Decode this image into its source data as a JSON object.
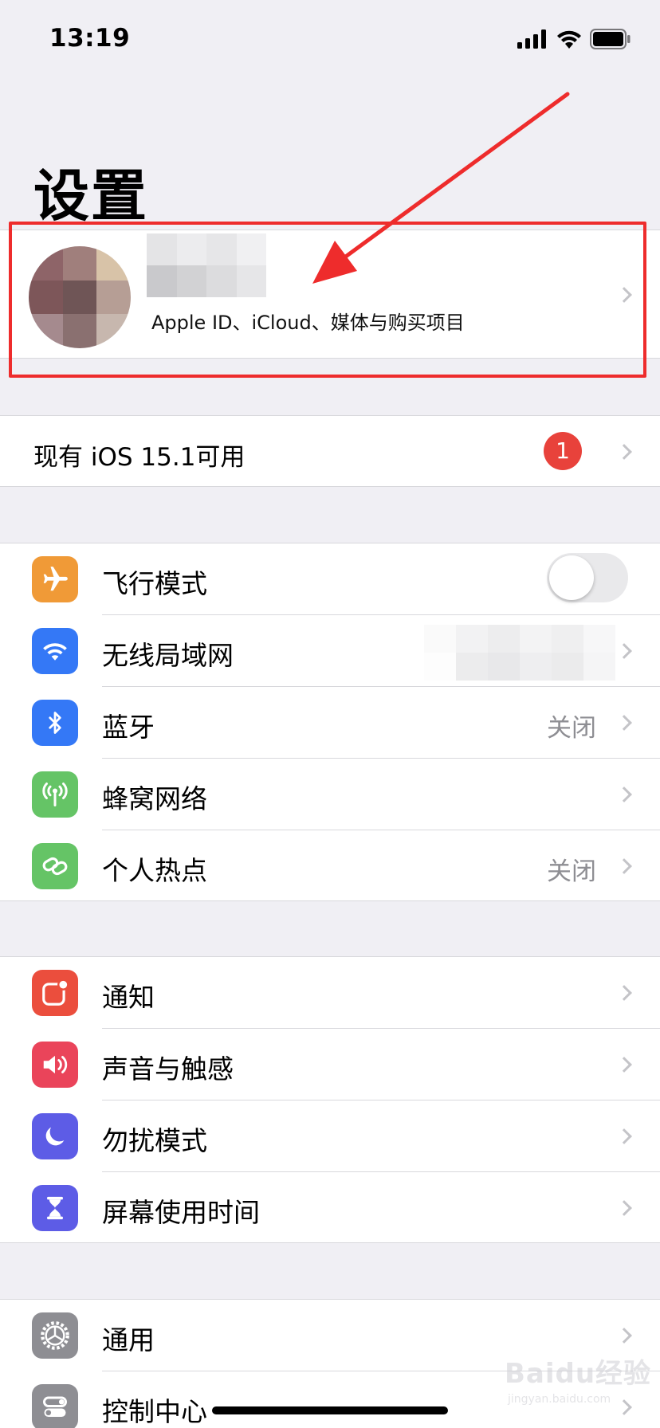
{
  "status_bar": {
    "time": "13:19"
  },
  "header": {
    "title": "设置"
  },
  "profile": {
    "subtitle": "Apple ID、iCloud、媒体与购买项目"
  },
  "update": {
    "label": "现有 iOS 15.1可用",
    "badge": "1"
  },
  "connectivity": [
    {
      "label": "飞行模式",
      "icon": "airplane-icon",
      "color": "#f09a37",
      "control": "toggle",
      "toggle_on": false
    },
    {
      "label": "无线局域网",
      "icon": "wifi-icon",
      "color": "#3478f6",
      "value": ""
    },
    {
      "label": "蓝牙",
      "icon": "bluetooth-icon",
      "color": "#3478f6",
      "value": "关闭"
    },
    {
      "label": "蜂窝网络",
      "icon": "cellular-icon",
      "color": "#65c466",
      "value": ""
    },
    {
      "label": "个人热点",
      "icon": "hotspot-icon",
      "color": "#65c466",
      "value": "关闭"
    }
  ],
  "notifications_group": [
    {
      "label": "通知",
      "icon": "notifications-icon",
      "color": "#eb4e3d"
    },
    {
      "label": "声音与触感",
      "icon": "sound-icon",
      "color": "#ea445a"
    },
    {
      "label": "勿扰模式",
      "icon": "moon-icon",
      "color": "#5d5ce6"
    },
    {
      "label": "屏幕使用时间",
      "icon": "hourglass-icon",
      "color": "#5d5ce6"
    }
  ],
  "general_group": [
    {
      "label": "通用",
      "icon": "gear-icon",
      "color": "#8e8e93"
    },
    {
      "label": "控制中心",
      "icon": "control-center-icon",
      "color": "#8e8e93"
    }
  ],
  "watermark": {
    "logo": "Baidu经验",
    "url": "jingyan.baidu.com"
  }
}
